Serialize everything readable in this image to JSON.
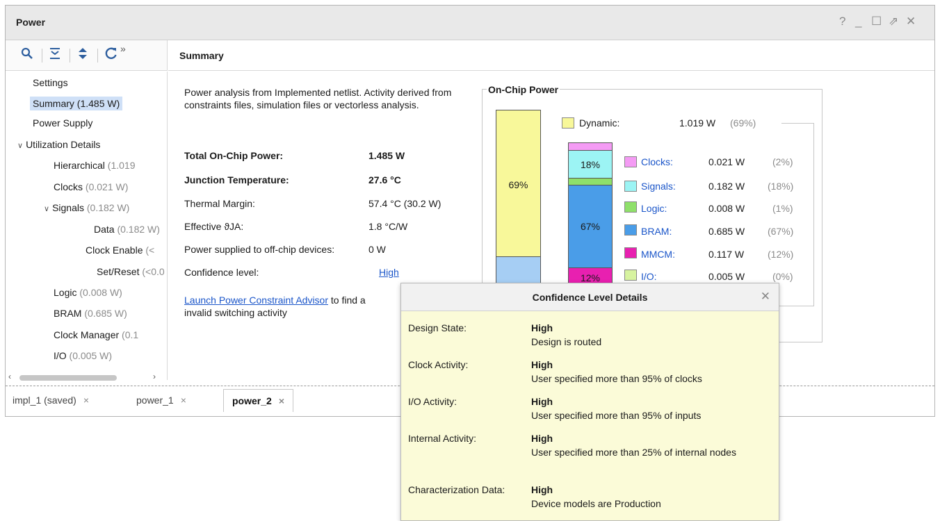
{
  "window": {
    "title": "Power",
    "controls": [
      "?",
      "_",
      "☐",
      "⇗",
      "✕"
    ]
  },
  "toolbar": {
    "icons": [
      "search-icon",
      "collapse-all-icon",
      "expand-all-icon",
      "refresh-icon",
      "more-icon"
    ],
    "more_label": "»"
  },
  "summary_header": "Summary",
  "tree": {
    "items": [
      {
        "label": "Settings",
        "value": ""
      },
      {
        "label": "Summary (1.485 W)",
        "value": ""
      },
      {
        "label": "Power Supply",
        "value": ""
      },
      {
        "label": "Utilization Details",
        "value": ""
      },
      {
        "label": "Hierarchical",
        "value": " (1.019"
      },
      {
        "label": "Clocks",
        "value": " (0.021 W)"
      },
      {
        "label": "Signals",
        "value": " (0.182 W)"
      },
      {
        "label": "Data",
        "value": " (0.182 W)"
      },
      {
        "label": "Clock Enable",
        "value": " (<"
      },
      {
        "label": "Set/Reset",
        "value": " (<0.0"
      },
      {
        "label": "Logic",
        "value": " (0.008 W)"
      },
      {
        "label": "BRAM",
        "value": " (0.685 W)"
      },
      {
        "label": "Clock Manager",
        "value": " (0.1"
      },
      {
        "label": "I/O",
        "value": " (0.005 W)"
      }
    ]
  },
  "summary": {
    "description": "Power analysis from Implemented netlist. Activity derived from constraints files, simulation files or vectorless analysis.",
    "rows": [
      {
        "label": "Total On-Chip Power:",
        "value": "1.485 W"
      },
      {
        "label": "Junction Temperature:",
        "value": "27.6 °C"
      },
      {
        "label": "Thermal Margin:",
        "value": "57.4 °C (30.2 W)"
      },
      {
        "label": "Effective ϑJA:",
        "value": "1.8 °C/W"
      },
      {
        "label": "Power supplied to off-chip devices:",
        "value": "0 W"
      },
      {
        "label": "Confidence level:",
        "value": "High"
      }
    ],
    "advisor_link": "Launch Power Constraint Advisor",
    "advisor_text_1": " to find a",
    "advisor_text_2": "invalid switching activity"
  },
  "onchip": {
    "title": "On-Chip Power",
    "dynamic_label": "Dynamic:",
    "dynamic_watts": "1.019 W",
    "dynamic_pct": "(69%)",
    "main_bar_label": "69%",
    "legend": [
      {
        "name": "Clocks:",
        "watts": "0.021 W",
        "pct": "(2%)",
        "color": "#f49bf4"
      },
      {
        "name": "Signals:",
        "watts": "0.182 W",
        "pct": "(18%)",
        "color": "#9cf4f4"
      },
      {
        "name": "Logic:",
        "watts": "0.008 W",
        "pct": "(1%)",
        "color": "#8fe06a"
      },
      {
        "name": "BRAM:",
        "watts": "0.685 W",
        "pct": "(67%)",
        "color": "#4a9de8"
      },
      {
        "name": "MMCM:",
        "watts": "0.117 W",
        "pct": "(12%)",
        "color": "#e820b0"
      },
      {
        "name": "I/O:",
        "watts": "0.005 W",
        "pct": "(0%)",
        "color": "#d7f3a0"
      }
    ],
    "breakdown_labels": {
      "signals": "18%",
      "bram": "67%",
      "mmcm": "12%"
    }
  },
  "tabs": [
    {
      "label": "impl_1 (saved)",
      "close": "×"
    },
    {
      "label": "power_1",
      "close": "×"
    },
    {
      "label": "power_2",
      "close": "×"
    }
  ],
  "popup": {
    "title": "Confidence Level Details",
    "close": "✕",
    "rows": [
      {
        "label": "Design State:",
        "value": "High",
        "desc": "Design is routed"
      },
      {
        "label": "Clock Activity:",
        "value": "High",
        "desc": "User specified more than 95% of clocks"
      },
      {
        "label": "I/O Activity:",
        "value": "High",
        "desc": "User specified more than 95% of inputs"
      },
      {
        "label": "Internal Activity:",
        "value": "High",
        "desc": "User specified more than 25% of internal nodes"
      },
      {
        "label": "Characterization Data:",
        "value": "High",
        "desc": "Device models are Production"
      }
    ]
  }
}
